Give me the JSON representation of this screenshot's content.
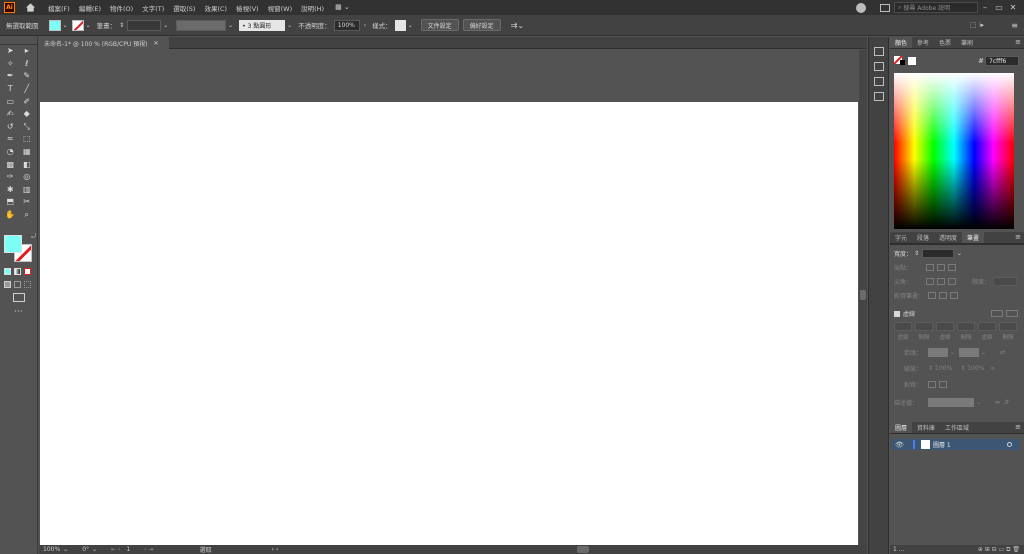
{
  "menubar": {
    "logo": "Ai",
    "items": [
      "檔案(F)",
      "編輯(E)",
      "物件(O)",
      "文字(T)",
      "選取(S)",
      "效果(C)",
      "檢視(V)",
      "視窗(W)",
      "說明(H)"
    ],
    "workspace_switcher": "▦ ⌄",
    "search_placeholder": "搜尋 Adobe 說明"
  },
  "control_bar": {
    "selection_state": "無選取範圍",
    "stroke_label": "筆畫：",
    "brush_profile": "• 3 點圓形",
    "opacity_label": "不透明度：",
    "opacity_value": "100%",
    "style_label": "樣式：",
    "document_setup_button": "文件設定",
    "preferences_button": "偏好設定"
  },
  "colors": {
    "fill": "#7cfff6",
    "ui_dark": "#323232",
    "ui_mid": "#535353",
    "layer_selected": "#3c5674"
  },
  "document": {
    "tab_title": "未命名-1* @ 100 % (RGB/CPU 預視)"
  },
  "status_bar": {
    "zoom": "100%",
    "rotation": "0°",
    "artboard_number": "1",
    "tool_name": "選取"
  },
  "color_panel": {
    "tabs": [
      "顏色",
      "參考",
      "色票",
      "筆刷"
    ],
    "active_tab": "顏色",
    "hex_value": "7cfff6"
  },
  "stroke_panel": {
    "tabs": [
      "字元",
      "段落",
      "透明度",
      "筆畫"
    ],
    "active_tab": "筆畫",
    "weight_label": "寬度：",
    "cap_label": "端點：",
    "corner_label": "尖角：",
    "limit_label": "限度：",
    "align_label": "對齊筆畫：",
    "dashed_label": "虛線",
    "dash_labels": [
      "虛線",
      "間隔",
      "虛線",
      "間隔",
      "虛線",
      "間隔"
    ],
    "arrow_label": "箭頭：",
    "scale_label": "縮放：",
    "scale_value_1": "100%",
    "scale_value_2": "100%",
    "align_arrow_label": "對齊：",
    "profile_label": "描述檔："
  },
  "layers_panel": {
    "tabs": [
      "圖層",
      "資料庫",
      "工作區域"
    ],
    "active_tab": "圖層",
    "layers": [
      {
        "name": "圖層 1"
      }
    ],
    "footer_count": "1 ..."
  }
}
